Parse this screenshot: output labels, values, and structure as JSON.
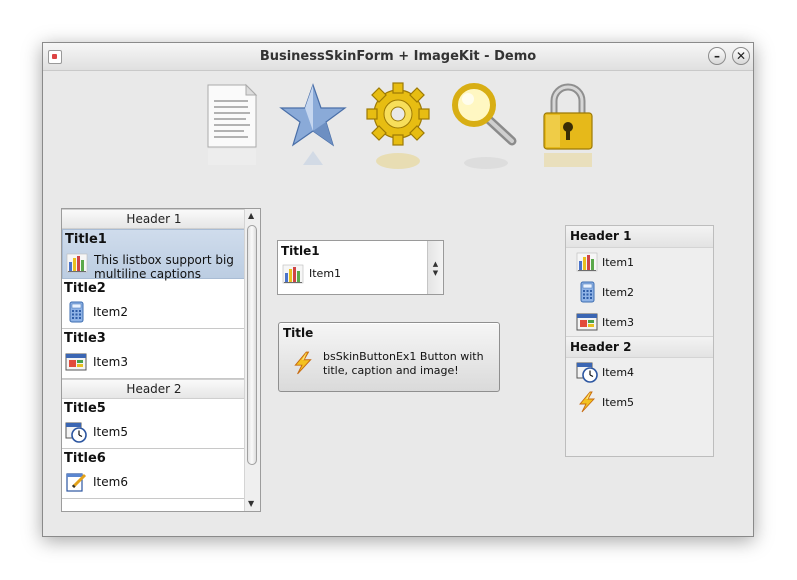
{
  "window": {
    "title": "BusinessSkinForm + ImageKit - Demo",
    "minimize_glyph": "–",
    "close_glyph": "✕"
  },
  "toolbar": {
    "icons": [
      "document-icon",
      "star-icon",
      "gear-icon",
      "magnifier-icon",
      "padlock-icon"
    ]
  },
  "listbox": {
    "header1": "Header 1",
    "header2": "Header 2",
    "items": [
      {
        "title": "Title1",
        "caption": "This listbox support big multiline captions",
        "icon": "bar-chart-icon",
        "selected": true
      },
      {
        "title": "Title2",
        "caption": "Item2",
        "icon": "calculator-icon"
      },
      {
        "title": "Title3",
        "caption": "Item3",
        "icon": "window-icon"
      },
      {
        "title": "Title5",
        "caption": "Item5",
        "icon": "clock-icon"
      },
      {
        "title": "Title6",
        "caption": "Item6",
        "icon": "edit-icon"
      }
    ],
    "scroll_up": "▲",
    "scroll_down": "▼"
  },
  "combobox": {
    "title": "Title1",
    "value": "Item1",
    "icon": "bar-chart-icon",
    "arrow_up": "▲",
    "arrow_down": "▼"
  },
  "skin_button": {
    "title": "Title",
    "caption": "bsSkinButtonEx1 Button with title, caption and image!",
    "icon": "lightning-icon"
  },
  "panel": {
    "header1": "Header 1",
    "header2": "Header 2",
    "group1": [
      {
        "label": "Item1",
        "icon": "bar-chart-icon"
      },
      {
        "label": "Item2",
        "icon": "calculator-icon"
      },
      {
        "label": "Item3",
        "icon": "window-icon"
      }
    ],
    "group2": [
      {
        "label": "Item4",
        "icon": "clock-icon"
      },
      {
        "label": "Item5",
        "icon": "lightning-icon"
      }
    ]
  },
  "colors": {
    "window_bg": "#e9e9e9",
    "selection": "#c4d3e8",
    "gold": "#e8c020",
    "star_blue": "#7d9fcf"
  }
}
